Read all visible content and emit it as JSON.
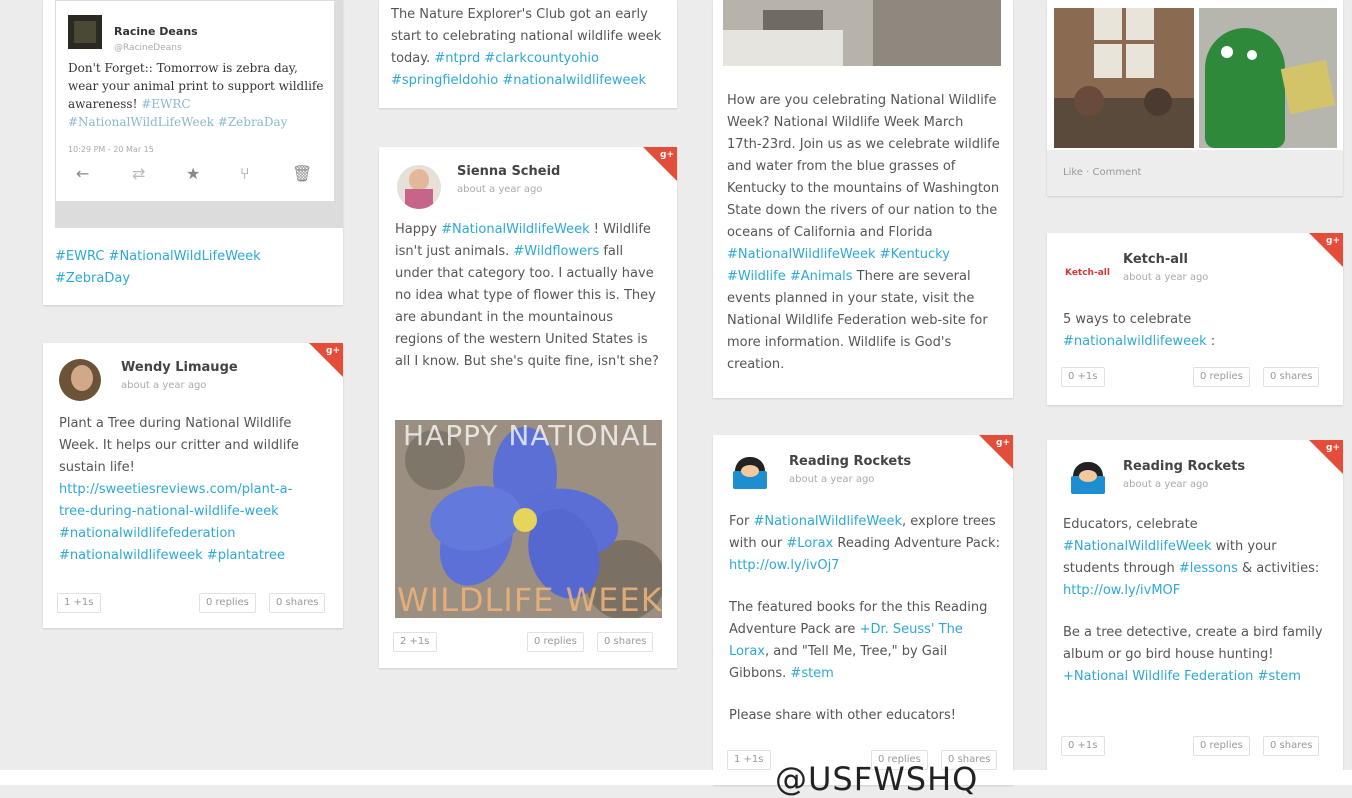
{
  "tweet": {
    "name": "Racine Deans",
    "handle": "@RacineDeans",
    "text_plain": "Don't Forget:: Tomorrow is zebra day, wear your animal print to support wildlife awareness! ",
    "text_tags": "#EWRC #NationalWildLifeWeek #ZebraDay",
    "timestamp": "10:29 PM - 20 Mar 15",
    "card_tags_line1": "#EWRC #NationalWildLifeWeek",
    "card_tags_line2": "#ZebraDay"
  },
  "card_nature": {
    "text_plain": "The Nature Explorer's Club got an early start to celebrating national wildlife week today. ",
    "tag1": "#ntprd",
    "tag2": "#clarkcountyohio",
    "tag3": "#springfieldohio",
    "tag4": "#nationalwildlifeweek"
  },
  "card_wendy": {
    "name": "Wendy Limauge",
    "time": "about a year ago",
    "text": "Plant a Tree during National Wildlife Week. It helps our critter and wildlife sustain life!",
    "link1": "http://sweetiesreviews.com/plant-a-",
    "link2": "tree-during-national-wildlife-week",
    "tag1": "#nationalwildlifefederation",
    "tag2": "#nationalwildlifeweek",
    "tag3": "#plantatree",
    "likes": "1 +1s",
    "replies": "0 replies",
    "shares": "0 shares"
  },
  "card_sienna": {
    "name": "Sienna Scheid",
    "time": "about a year ago",
    "happy": "Happy ",
    "tag1": "#NationalWildlifeWeek",
    "text1": " ! Wildlife isn't just animals.",
    "tag2": "#Wildflowers",
    "text2": " fall under that category too. I actually have no idea what type of flower this is. They are abundant in the mountainous regions of the western United States is all I know. But she's quite fine, isn't she?",
    "img_top": "HAPPY NATIONAL",
    "img_bottom": "WILDLIFE WEEK",
    "likes": "2 +1s",
    "replies": "0 replies",
    "shares": "0 shares"
  },
  "card_celebrate": {
    "text1": "How are you celebrating National Wildlife Week? National Wildlife Week March 17th-23rd. Join us as we celebrate wildlife and water from the blue grasses of Kentucky to the mountains of Washington State down the rivers of our nation to the oceans of California and Florida ",
    "tag1": "#NationalWildlifeWeek",
    "tag2": "#Kentucky",
    "tag3": "#Wildlife",
    "tag4": "#Animals",
    "text2": " There are several events planned in your state, visit the National Wildlife Federation web-site for more information. Wildlife is God's creation."
  },
  "card_rr1": {
    "name": "Reading Rockets",
    "time": "about a year ago",
    "for": "For ",
    "tag1": "#NationalWildlifeWeek",
    "text1": ", explore trees with our ",
    "tag2": "#Lorax",
    "text2": " Reading Adventure Pack: ",
    "link": "http://ow.ly/ivOj7",
    "text3": "The featured books for the this Reading Adventure Pack are ",
    "link2": "+Dr. Seuss' The Lorax",
    "text4": ", and \"Tell Me, Tree,\" by Gail Gibbons. ",
    "tag3": "#stem",
    "text5": "Please share with other educators!",
    "likes": "1 +1s",
    "replies": "0 replies",
    "shares": "0 shares"
  },
  "card_photo": {
    "actions": "Like · Comment"
  },
  "card_ketch": {
    "name": "Ketch-all",
    "logo": "Ketch-all",
    "time": "about a year ago",
    "text": "5 ways to celebrate ",
    "tag": "#nationalwildlifeweek",
    "tail": " :",
    "likes": "0 +1s",
    "replies": "0 replies",
    "shares": "0 shares"
  },
  "card_rr2": {
    "name": "Reading Rockets",
    "time": "about a year ago",
    "text1": "Educators, celebrate ",
    "tag1": "#NationalWildlifeWeek",
    "text2": " with your students through ",
    "tag2": "#lessons",
    "text3": " & activities: ",
    "link": "http://ow.ly/ivMOF",
    "text4": "Be a tree detective, create a bird family album or go bird house hunting! ",
    "link2": "+National Wildlife Federation",
    "tag3": " #stem",
    "likes": "0 +1s",
    "replies": "0 replies",
    "shares": "0 shares"
  },
  "watermark": "@USFWSHQ"
}
